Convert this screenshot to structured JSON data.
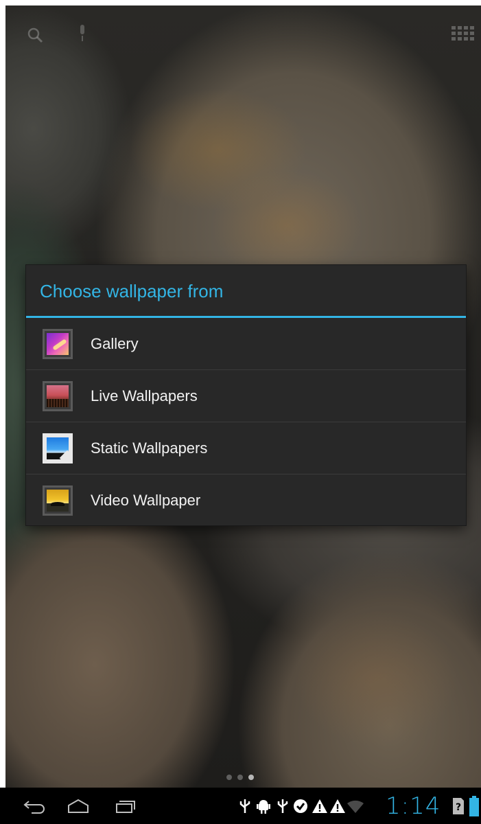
{
  "dialog": {
    "title": "Choose wallpaper from",
    "options": [
      {
        "label": "Gallery",
        "icon": "gallery-icon"
      },
      {
        "label": "Live Wallpapers",
        "icon": "live-wallpapers-icon"
      },
      {
        "label": "Static Wallpapers",
        "icon": "static-wallpapers-icon"
      },
      {
        "label": "Video Wallpaper",
        "icon": "video-wallpaper-icon"
      }
    ]
  },
  "home": {
    "top_icons": [
      "search-icon",
      "microphone-icon",
      "apps-grid-icon"
    ],
    "page_dots": {
      "count": 3,
      "active_index": 2
    }
  },
  "status_bar": {
    "clock": "1:14",
    "nav_buttons": [
      "back-icon",
      "home-icon",
      "recent-apps-icon"
    ],
    "notification_icons": [
      "usb-icon",
      "android-debug-icon",
      "usb-icon",
      "check-notification-icon",
      "warning-icon",
      "warning-icon",
      "wifi-icon"
    ],
    "system_icons": [
      "sim-unknown-icon",
      "battery-icon"
    ]
  },
  "colors": {
    "accent": "#33b5e5",
    "dialog_bg": "#282828",
    "text": "#f2f2f2",
    "bar_bg": "#000000"
  }
}
